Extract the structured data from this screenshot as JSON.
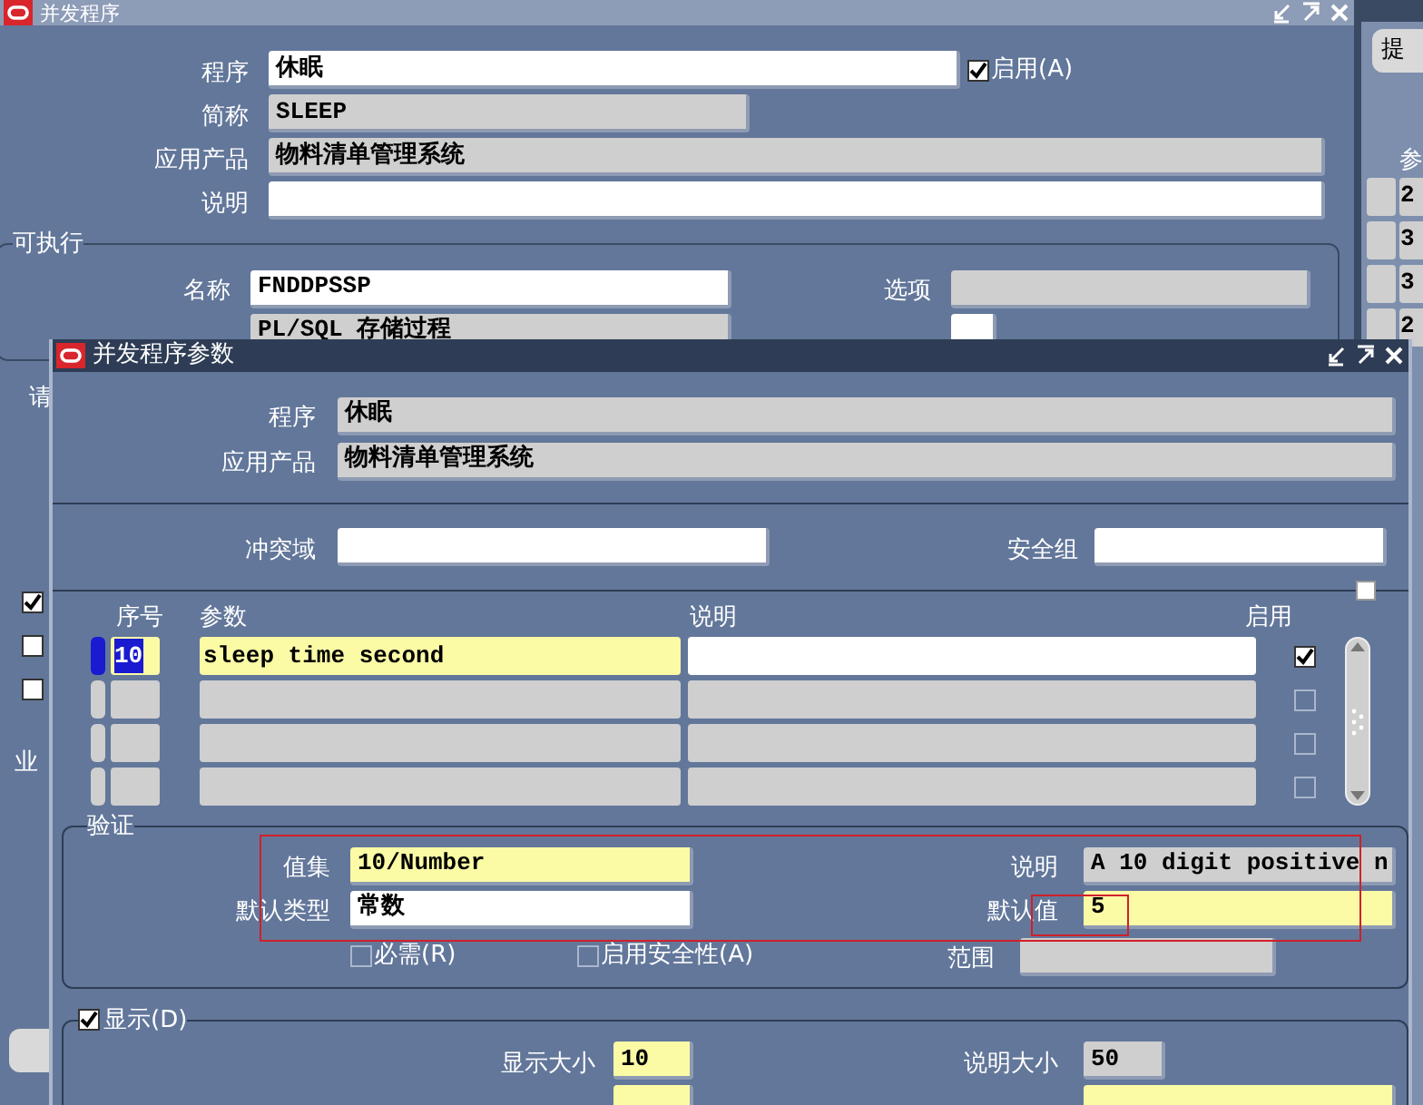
{
  "background_window": {
    "title": "并发程序",
    "program": {
      "label": "程序",
      "value": "休眠"
    },
    "enabled": {
      "label": "启用(A)",
      "checked": true
    },
    "short_name": {
      "label": "简称",
      "value": "SLEEP"
    },
    "application": {
      "label": "应用产品",
      "value": "物料清单管理系统"
    },
    "description": {
      "label": "说明"
    },
    "executable": {
      "title": "可执行",
      "name": {
        "label": "名称",
        "value": "FNDDPSSP"
      },
      "options": {
        "label": "选项"
      },
      "method": {
        "value": "PL/SQL 存储过程"
      }
    },
    "left_strip": {
      "label": "请",
      "checkboxes": [
        {
          "checked": true
        },
        {
          "checked": false
        },
        {
          "checked": false
        }
      ],
      "label_2": "业"
    }
  },
  "side_window": {
    "button": "提",
    "column_label": "参",
    "cells": [
      "2",
      "3",
      "3",
      "2"
    ]
  },
  "dialog": {
    "title": "并发程序参数",
    "program": {
      "label": "程序",
      "value": "休眠"
    },
    "application": {
      "label": "应用产品",
      "value": "物料清单管理系统"
    },
    "conflict_domain": {
      "label": "冲突域"
    },
    "security_group": {
      "label": "安全组"
    },
    "table": {
      "columns": [
        "序号",
        "参数",
        "说明",
        "启用"
      ],
      "rows": [
        {
          "seq": "10",
          "parameter": "sleep time second",
          "selected": true,
          "enabled": true
        },
        {
          "selected": false,
          "enabled": false
        },
        {
          "selected": false,
          "enabled": false
        },
        {
          "selected": false,
          "enabled": false
        }
      ]
    },
    "validation": {
      "title": "验证",
      "value_set": {
        "label": "值集",
        "value": "10/Number"
      },
      "description": {
        "label": "说明",
        "value": "A 10 digit positive n"
      },
      "default_type": {
        "label": "默认类型",
        "value": "常数"
      },
      "default_value": {
        "label": "默认值",
        "value": "5"
      },
      "required": {
        "label": "必需(R)",
        "checked": false
      },
      "enable_security": {
        "label": "启用安全性(A)",
        "checked": false
      },
      "range": {
        "label": "范围"
      }
    },
    "display": {
      "label": "显示(D)",
      "checked": true,
      "display_size": {
        "label": "显示大小",
        "value": "10"
      },
      "description_size": {
        "label": "说明大小",
        "value": "50"
      }
    }
  }
}
